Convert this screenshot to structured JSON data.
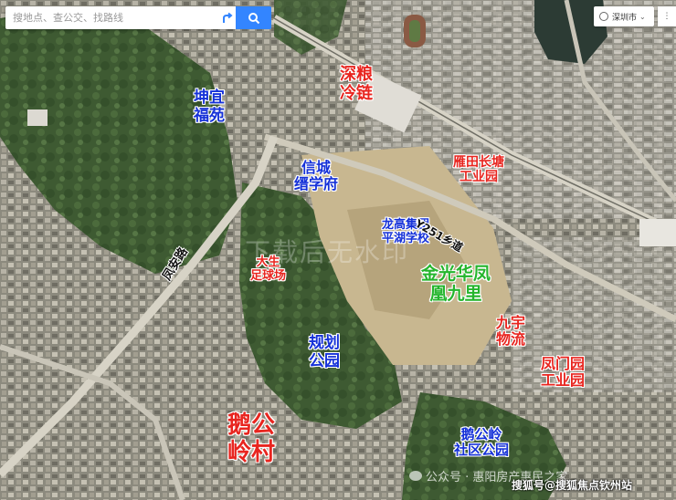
{
  "search": {
    "placeholder": "搜地点、查公交、找路线"
  },
  "city_selector": {
    "label": "深圳市"
  },
  "labels": {
    "kunyi": "坤宜\n福苑",
    "shenliang": "深粮\n冷链",
    "xincheng": "信城\n缙学府",
    "yantian": "雁田长塘\n工业园",
    "longgao": "龙高集团\n平湖学校",
    "dasheng": "大生\n足球场",
    "jinguang": "金光华凤\n凰九里",
    "guihua": "规划\n公园",
    "jiuyu": "九宇\n物流",
    "fengmen": "凤门园\n工业园",
    "egong": "鹅公\n岭村",
    "egongpark": "鹅公岭\n社区公园"
  },
  "roads": {
    "y251": "Y251乡道",
    "fengan": "凤安路"
  },
  "watermarks": {
    "center": "下载后无水印",
    "wechat": "公众号 · 惠阳房产惠民之家",
    "sohu": "搜狐号@搜狐焦点钦州站"
  },
  "colors": {
    "accent": "#3385ff",
    "blue_label": "#1531d8",
    "red_label": "#e8251f",
    "green_label": "#24b52c"
  }
}
